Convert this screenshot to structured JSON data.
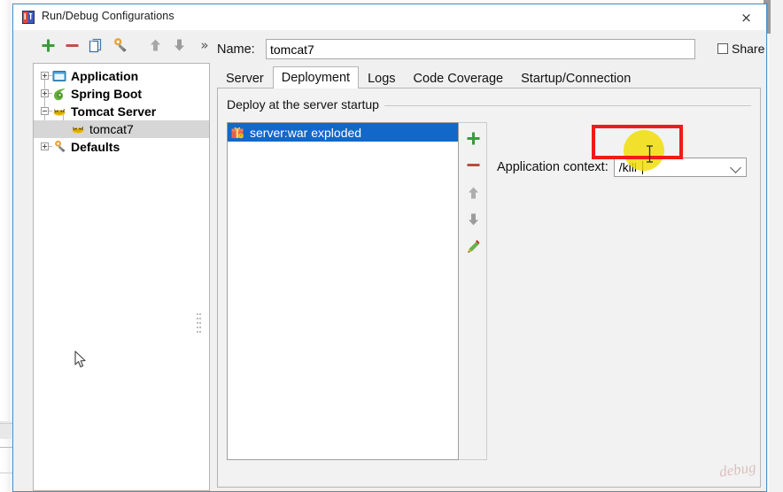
{
  "window": {
    "title": "Run/Debug Configurations",
    "icon": "intellij-idea-icon",
    "close_label": "×"
  },
  "toolbar": {
    "buttons": [
      {
        "name": "add-configuration-button",
        "icon": "plus-icon",
        "glyph": "+"
      },
      {
        "name": "remove-configuration-button",
        "icon": "minus-icon",
        "glyph": "−"
      },
      {
        "name": "copy-configuration-button",
        "icon": "copy-icon",
        "glyph": "⧉"
      },
      {
        "name": "edit-templates-button",
        "icon": "wrench-icon",
        "glyph": "⚒"
      },
      {
        "name": "move-up-button",
        "icon": "arrow-up-icon",
        "glyph": "↑"
      },
      {
        "name": "move-down-button",
        "icon": "arrow-down-icon",
        "glyph": "↓"
      },
      {
        "name": "more-actions-button",
        "icon": "chevron-double-right-icon",
        "glyph": "»"
      }
    ]
  },
  "name_field": {
    "label": "Name:",
    "value": "tomcat7",
    "placeholder": ""
  },
  "share": {
    "label": "Share",
    "checked": false
  },
  "tree": {
    "items": [
      {
        "label": "Application",
        "icon": "application-icon",
        "depth": 0,
        "expander": "plus",
        "bold": true,
        "selected": false
      },
      {
        "label": "Spring Boot",
        "icon": "spring-boot-icon",
        "depth": 0,
        "expander": "plus",
        "bold": true,
        "selected": false
      },
      {
        "label": "Tomcat Server",
        "icon": "tomcat-icon",
        "depth": 0,
        "expander": "minus",
        "bold": true,
        "selected": false
      },
      {
        "label": "tomcat7",
        "icon": "tomcat-icon",
        "depth": 1,
        "expander": "none",
        "bold": false,
        "selected": true
      },
      {
        "label": "Defaults",
        "icon": "wrench-icon",
        "depth": 0,
        "expander": "plus",
        "bold": true,
        "selected": false
      }
    ]
  },
  "tabs": [
    {
      "label": "Server",
      "active": false
    },
    {
      "label": "Deployment",
      "active": true
    },
    {
      "label": "Logs",
      "active": false
    },
    {
      "label": "Code Coverage",
      "active": false
    },
    {
      "label": "Startup/Connection",
      "active": false
    }
  ],
  "deployment": {
    "group_title": "Deploy at the server startup",
    "artifacts": [
      {
        "label": "server:war exploded",
        "icon": "artifact-icon",
        "selected": true
      }
    ],
    "list_toolbar": [
      {
        "name": "add-artifact-button",
        "icon": "plus-icon",
        "glyph": "+"
      },
      {
        "name": "remove-artifact-button",
        "icon": "minus-icon",
        "glyph": "−"
      },
      {
        "name": "move-artifact-up-button",
        "icon": "arrow-up-icon",
        "glyph": "↑"
      },
      {
        "name": "move-artifact-down-button",
        "icon": "arrow-down-icon",
        "glyph": "↓"
      },
      {
        "name": "edit-artifact-button",
        "icon": "pencil-icon",
        "glyph": "✎"
      }
    ],
    "application_context": {
      "label": "Application context:",
      "value": "/kill",
      "placeholder": ""
    }
  },
  "annotations": {
    "highlight_color": "#f01a1a",
    "click_marker_color": "#f1dd00",
    "watermark": "debug"
  },
  "colors": {
    "selection_blue": "#1268c8",
    "dialog_border": "#4a90c4",
    "tree_selection_grey": "#d6d6d6"
  }
}
